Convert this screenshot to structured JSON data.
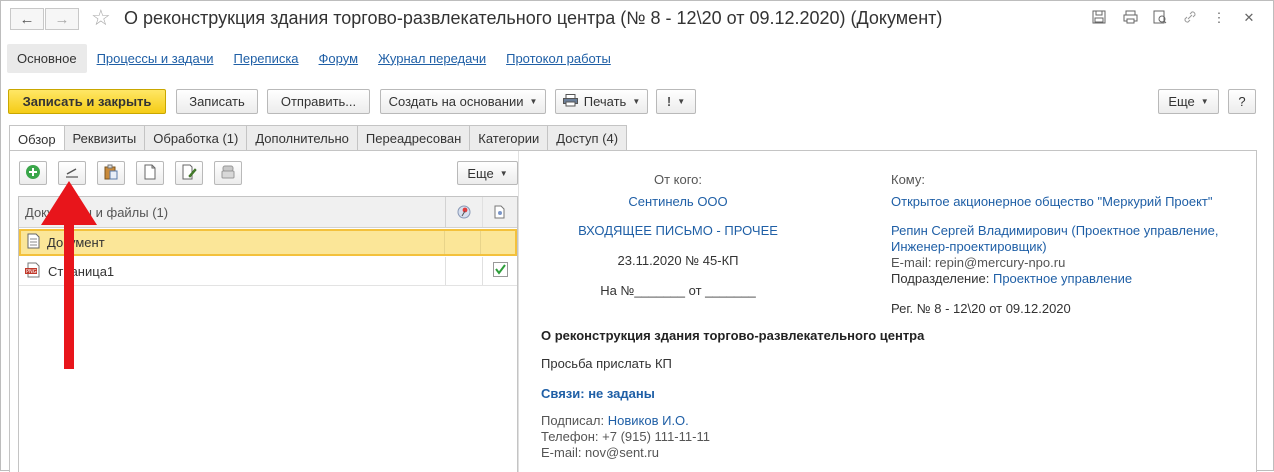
{
  "window": {
    "title": "О реконструкция здания торгово-развлекательного центра (№ 8 - 12\\20 от 09.12.2020) (Документ)"
  },
  "sections": {
    "active": "Основное",
    "links": [
      "Процессы и задачи",
      "Переписка",
      "Форум",
      "Журнал передачи",
      "Протокол работы"
    ]
  },
  "toolbar": {
    "save_close": "Записать и закрыть",
    "save": "Записать",
    "send": "Отправить...",
    "create_based": "Создать на основании",
    "print": "Печать",
    "more": "Еще",
    "help": "?",
    "exclaim": "!"
  },
  "tabs": [
    "Обзор",
    "Реквизиты",
    "Обработка (1)",
    "Дополнительно",
    "Переадресован",
    "Категории",
    "Доступ (4)"
  ],
  "files": {
    "more": "Еще",
    "header": "Документы и файлы (1)",
    "rows": [
      {
        "name": "Документ",
        "checked": false
      },
      {
        "name": "Страница1",
        "checked": true
      }
    ]
  },
  "details": {
    "from_label": "От кого:",
    "from_value": "Сентинель ООО",
    "doc_type": "ВХОДЯЩЕЕ ПИСЬМО - ПРОЧЕЕ",
    "doc_date_num": "23.11.2020 № 45-КП",
    "reply_to": "На №_______ от _______",
    "to_label": "Кому:",
    "to_org": "Открытое акционерное общество \"Меркурий Проект\"",
    "to_person_line1": "Репин Сергей Владимирович (Проектное управление,",
    "to_person_line2": "Инженер-проектировщик)",
    "email_line": "E-mail: repin@mercury-npo.ru",
    "dept_label": "Подразделение:",
    "dept_value": "Проектное управление",
    "reg": "Рег. № 8 - 12\\20 от 09.12.2020",
    "subject": "О реконструкция здания торгово-развлекательного центра",
    "body": "Просьба прислать КП",
    "links": "Связи: не заданы",
    "signed_label": "Подписал:",
    "signed_value": "Новиков И.О.",
    "phone": "Телефон: +7 (915) 111-11-11",
    "email": "E-mail: nov@sent.ru"
  }
}
